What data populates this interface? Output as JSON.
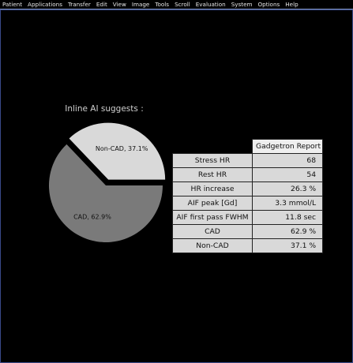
{
  "menubar": {
    "items": [
      "Patient",
      "Applications",
      "Transfer",
      "Edit",
      "View",
      "Image",
      "Tools",
      "Scroll",
      "Evaluation",
      "System",
      "Options",
      "Help"
    ]
  },
  "chart_data": {
    "type": "pie",
    "title": "Inline AI suggests :",
    "slices": [
      {
        "label": "Non-CAD, 37.1%",
        "value": 37.1,
        "color": "#d9d9d9",
        "exploded": true
      },
      {
        "label": "CAD, 62.9%",
        "value": 62.9,
        "color": "#7a7a7a",
        "exploded": false
      }
    ]
  },
  "report": {
    "header": "Gadgetron Report",
    "rows": [
      {
        "label": "Stress HR",
        "value": "68"
      },
      {
        "label": "Rest HR",
        "value": "54"
      },
      {
        "label": "HR increase",
        "value": "26.3 %"
      },
      {
        "label": "AIF peak [Gd]",
        "value": "3.3 mmol/L"
      },
      {
        "label": "AIF first pass FWHM",
        "value": "11.8 sec"
      },
      {
        "label": "CAD",
        "value": "62.9 %"
      },
      {
        "label": "Non-CAD",
        "value": "37.1 %"
      }
    ]
  }
}
